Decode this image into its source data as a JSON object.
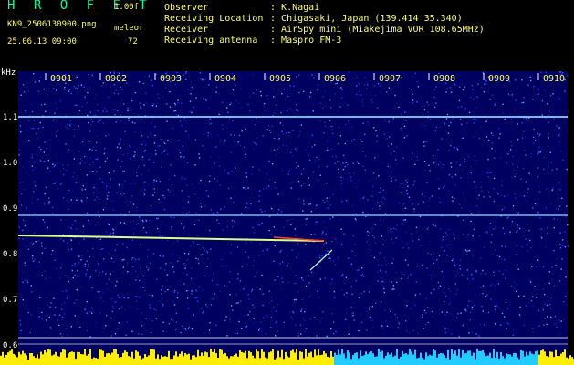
{
  "header": {
    "app_title": "H R O F F T",
    "version": "1.00f",
    "filename": "KN9_2506130900.png",
    "datetime": "25.06.13 09:00",
    "mode_label": "meleor",
    "count": "72"
  },
  "info": [
    {
      "label": "Observer",
      "value": "K.Nagai"
    },
    {
      "label": "Receiving Location",
      "value": "Chigasaki, Japan (139.414 35.340)"
    },
    {
      "label": "Receiver",
      "value": "AirSpy mini (Miakejima VOR 108.65MHz)"
    },
    {
      "label": "Receiving antenna",
      "value": "Maspro FM-3"
    }
  ],
  "spectrogram": {
    "unit_label": "kHz",
    "y_ticks": [
      "1.1",
      "1.0",
      "0.9",
      "0.8",
      "0.7",
      "0.6"
    ],
    "time_ticks": [
      "0901",
      "0902",
      "0903",
      "0904",
      "0905",
      "0906",
      "0907",
      "0908",
      "0909",
      "0910"
    ],
    "colors": {
      "background": "#000060",
      "carrier": "#88ddff",
      "meteor": "#ffee00",
      "baseline": "#ffff00"
    }
  }
}
